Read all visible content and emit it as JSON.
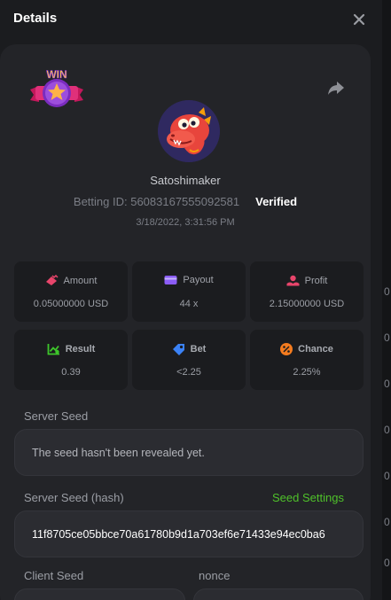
{
  "header": {
    "title": "Details",
    "close_icon": "close-icon"
  },
  "profile": {
    "badge_text": "WIN",
    "username": "Satoshimaker",
    "betting_id": "Betting ID: 56083167555092581",
    "verified": "Verified",
    "date": "3/18/2022, 3:31:56 PM"
  },
  "stats": [
    {
      "label": "Amount",
      "value": "0.05000000 USD",
      "icon": "amount-icon",
      "color": "#e8456b"
    },
    {
      "label": "Payout",
      "value": "44 x",
      "icon": "wallet-icon",
      "color": "#8b5cf6"
    },
    {
      "label": "Profit",
      "value": "2.15000000 USD",
      "icon": "profit-icon",
      "color": "#e8456b"
    },
    {
      "label": "Result",
      "value": "0.39",
      "icon": "chart-icon",
      "color": "#3ec62b"
    },
    {
      "label": "Bet",
      "value": "<2.25",
      "icon": "tag-icon",
      "color": "#3b82f6"
    },
    {
      "label": "Chance",
      "value": "2.25%",
      "icon": "percent-icon",
      "color": "#f57c1f"
    }
  ],
  "server_seed": {
    "label": "Server Seed",
    "value": "The seed hasn't been revealed yet."
  },
  "server_seed_hash": {
    "label": "Server Seed (hash)",
    "settings_link": "Seed Settings",
    "value": "11f8705ce05bbce70a61780b9d1a703ef6e71433e94ec0ba6"
  },
  "client_seed": {
    "label": "Client Seed"
  },
  "nonce": {
    "label": "nonce"
  },
  "background_digits": [
    "0",
    "0",
    "0",
    "0",
    "0",
    "0",
    "0"
  ],
  "colors": {
    "accent_green": "#4fc22a",
    "card_bg": "#232428",
    "modal_bg": "#1b1c1f"
  }
}
